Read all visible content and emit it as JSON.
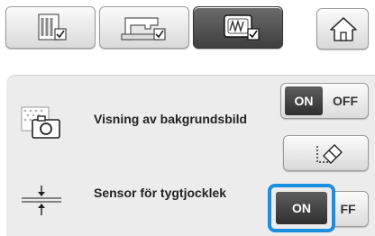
{
  "tabs": [
    {
      "name": "settings-general",
      "icon": "page-check-icon",
      "active": false
    },
    {
      "name": "settings-embroidery-machine",
      "icon": "sewing-machine-check-icon",
      "active": false
    },
    {
      "name": "settings-display",
      "icon": "hoop-display-check-icon",
      "active": true
    }
  ],
  "home": {
    "icon": "home-icon"
  },
  "settings": {
    "background_image": {
      "label": "Visning av bakgrundsbild",
      "icon": "camera-photo-icon",
      "toggle": {
        "on_label": "ON",
        "off_label": "OFF",
        "value": "ON"
      },
      "erase_icon": "eraser-icon"
    },
    "fabric_thickness_sensor": {
      "label": "Sensor för tygtjocklek",
      "icon": "fabric-thickness-icon",
      "toggle": {
        "on_label": "ON",
        "off_label": "OFF",
        "off_visible": "FF",
        "value": "ON"
      }
    }
  },
  "colors": {
    "accent_focus": "#1a8fe0",
    "active_segment": "#3a3a3a"
  }
}
